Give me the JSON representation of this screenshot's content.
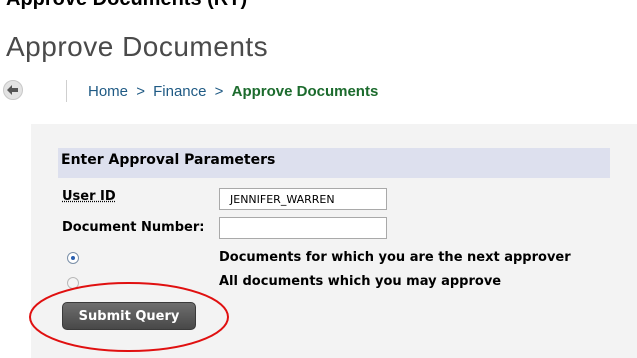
{
  "top_crop_text": "Approve Documents (RT)",
  "page": {
    "title": "Approve Documents"
  },
  "breadcrumb": {
    "home": "Home",
    "separator": ">",
    "finance": "Finance",
    "current": "Approve Documents"
  },
  "form": {
    "section_title": "Enter Approval Parameters",
    "user_id_label": "User ID",
    "user_id_value": "JENNIFER_WARREN",
    "doc_number_label": "Document Number:",
    "doc_number_value": "",
    "options": [
      {
        "label": "Documents for which you are the next approver",
        "selected": true
      },
      {
        "label": "All documents which you may approve",
        "selected": false
      }
    ],
    "submit_label": "Submit Query"
  },
  "colors": {
    "breadcrumb_link": "#1f5a84",
    "breadcrumb_current": "#1c6b2d",
    "section_header_bg": "#dde0ee",
    "annotation_circle": "#e01010"
  },
  "icons": {
    "back": "back-arrow-icon",
    "annotation": "red-circle-annotation"
  }
}
